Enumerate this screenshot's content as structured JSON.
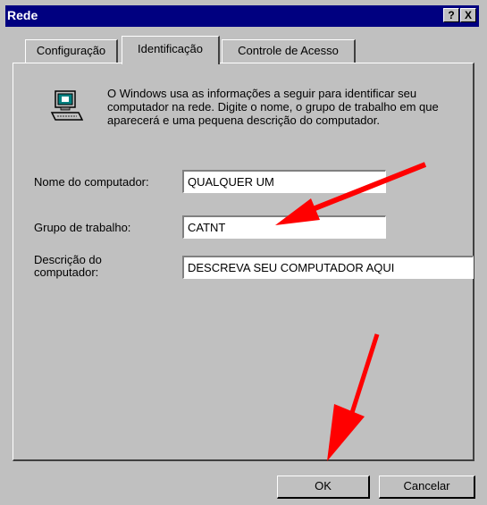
{
  "window": {
    "title": "Rede",
    "help_label": "?",
    "close_label": "X"
  },
  "tabs": [
    {
      "label": "Configuração"
    },
    {
      "label": "Identificação",
      "active": true
    },
    {
      "label": "Controle de Acesso"
    }
  ],
  "info_text": "O Windows usa as informações a seguir para identificar seu computador na rede. Digite o nome, o grupo de trabalho em que aparecerá e uma pequena descrição do computador.",
  "fields": {
    "computer_name": {
      "label": "Nome do computador:",
      "value": "QUALQUER UM"
    },
    "workgroup": {
      "label": "Grupo de trabalho:",
      "value": "CATNT"
    },
    "description": {
      "label_line1": "Descrição do",
      "label_line2": "computador:",
      "value": "DESCREVA SEU COMPUTADOR AQUI"
    }
  },
  "buttons": {
    "ok": "OK",
    "cancel": "Cancelar"
  },
  "colors": {
    "title_bar": "#000080",
    "dialog_bg": "#c0c0c0",
    "arrow": "#ff0000"
  }
}
